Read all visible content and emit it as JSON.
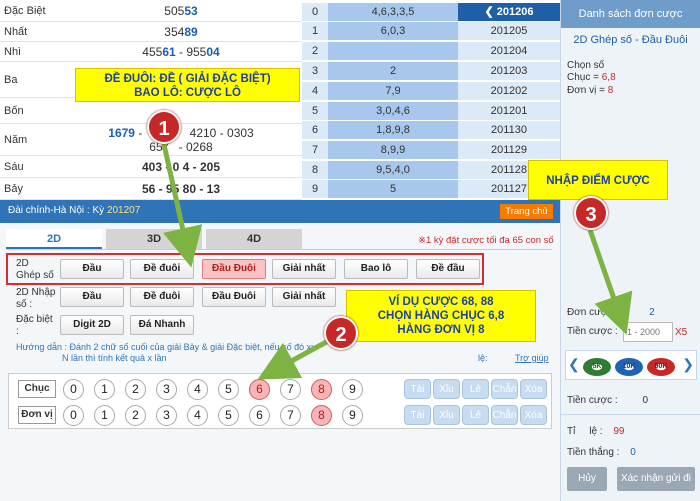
{
  "results": [
    {
      "label": "Đặc Biệt",
      "plain": "505",
      "bold": "53"
    },
    {
      "label": "Nhất",
      "plain": "354",
      "bold": "89"
    },
    {
      "label": "Nhì",
      "plain": "455",
      "bold": "61",
      "plain2": " - 955",
      "bold2": "04"
    },
    {
      "label": "Ba",
      "line1": "",
      "line2": ""
    },
    {
      "label": "Bốn",
      "line1": "",
      "line2": ""
    },
    {
      "label": "Năm",
      "line1a": "1679",
      "line1b": " - ",
      "line1c": "4210 - 0303",
      "line2a": "657",
      "line2b": " - 0268"
    },
    {
      "label": "Sáu",
      "text": "403 - 0 4 - 205"
    },
    {
      "label": "Bảy",
      "text": "56 - 95 80 - 13"
    }
  ],
  "loto": [
    {
      "head": "0",
      "tails": "4,6,3,3,5",
      "period": "201206",
      "selected": true
    },
    {
      "head": "1",
      "tails": "6,0,3",
      "period": "201205"
    },
    {
      "head": "2",
      "tails": "",
      "period": "201204"
    },
    {
      "head": "3",
      "tails": "2",
      "period": "201203"
    },
    {
      "head": "4",
      "tails": "7,9",
      "period": "201202"
    },
    {
      "head": "5",
      "tails": "3,0,4,6",
      "period": "201201"
    },
    {
      "head": "6",
      "tails": "1,8,9,8",
      "period": "201130"
    },
    {
      "head": "7",
      "tails": "8,9,9",
      "period": "201129"
    },
    {
      "head": "8",
      "tails": "9,5,4,0",
      "period": "201128"
    },
    {
      "head": "9",
      "tails": "5",
      "period": "201127"
    }
  ],
  "infobar": {
    "station": "Đài chính-Hà Nội  :  Kỳ",
    "period": "201207",
    "home": "Trang chủ"
  },
  "tabs": [
    "2D",
    "3D",
    "4D"
  ],
  "limit_note": "※1 kỳ đặt cược tối đa 65 con số",
  "rows": [
    {
      "label": "2D Ghép số :",
      "options": [
        "Đầu",
        "Đề đuôi",
        "Đầu Đuôi",
        "Giải nhất",
        "Bao lô",
        "Đề đầu"
      ]
    },
    {
      "label": "2D Nhập số :",
      "options": [
        "Đầu",
        "Đề đuôi",
        "Đầu Đuôi",
        "Giải nhất"
      ]
    },
    {
      "label": "Đặc biệt :",
      "options": [
        "Digit 2D",
        "Đá Nhanh"
      ]
    }
  ],
  "guide": {
    "title": "Hướng dẫn :",
    "line1": "Đánh 2 chữ số cuối của giải Bảy & giải Đặc biệt, nếu số đó xu",
    "line2": "N lần thì tính kết quả x lần",
    "help": "Trợ giúp",
    "tiny": "lệ:"
  },
  "picker": {
    "rows": [
      "Chục",
      "Đơn vị"
    ],
    "digits": [
      "0",
      "1",
      "2",
      "3",
      "4",
      "5",
      "6",
      "7",
      "8",
      "9"
    ],
    "selected_chuc": [
      "6",
      "8"
    ],
    "selected_donvi": [
      "8"
    ],
    "quick": [
      "Tài",
      "Xỉu",
      "Lẻ",
      "Chẵn",
      "Xóa"
    ]
  },
  "panel": {
    "title": "Danh sách đơn cược",
    "bet_type": "2D Ghép số - Đầu Đuôi",
    "chon_so": "Chọn số",
    "chuc_label": "Chục =",
    "chuc_value": "6,8",
    "donvi_label": "Đơn vị =",
    "donvi_value": "8",
    "don_cuoc": "Đơn cược",
    "don_cuoc_value": "2",
    "tien_cuoc": "Tiền cược :",
    "tien_placeholder": "1 - 2000",
    "multiplier": "X5",
    "chips": [
      "5K",
      "10K",
      "50K"
    ],
    "tong_tien": "Tiền cược :",
    "tong_value": "0",
    "ti_le": "Tỉ     lệ :",
    "ti_le_value": "99",
    "tien_thang": "Tiền thắng :",
    "tien_thang_value": "0",
    "cancel": "Hủy",
    "confirm": "Xác nhận gửi đi"
  },
  "notes": {
    "note1": [
      "ĐỀ ĐUÔI: ĐỀ ( GIẢI ĐẶC BIỆT)",
      "BAO LÔ: CƯỢC LÔ"
    ],
    "note2": [
      "VÍ DỤ CƯỢC 68, 88",
      "CHỌN HÀNG CHỤC 6,8",
      "HÀNG ĐƠN VỊ 8"
    ],
    "note3": "NHẬP ĐIỂM CƯỢC",
    "badges": [
      "1",
      "2",
      "3"
    ]
  },
  "colors": {
    "accent": "#2f74b8",
    "selected": "#f6b6b6",
    "note": "#ffff00",
    "badge": "#c62828",
    "arrow": "#7cb342"
  }
}
